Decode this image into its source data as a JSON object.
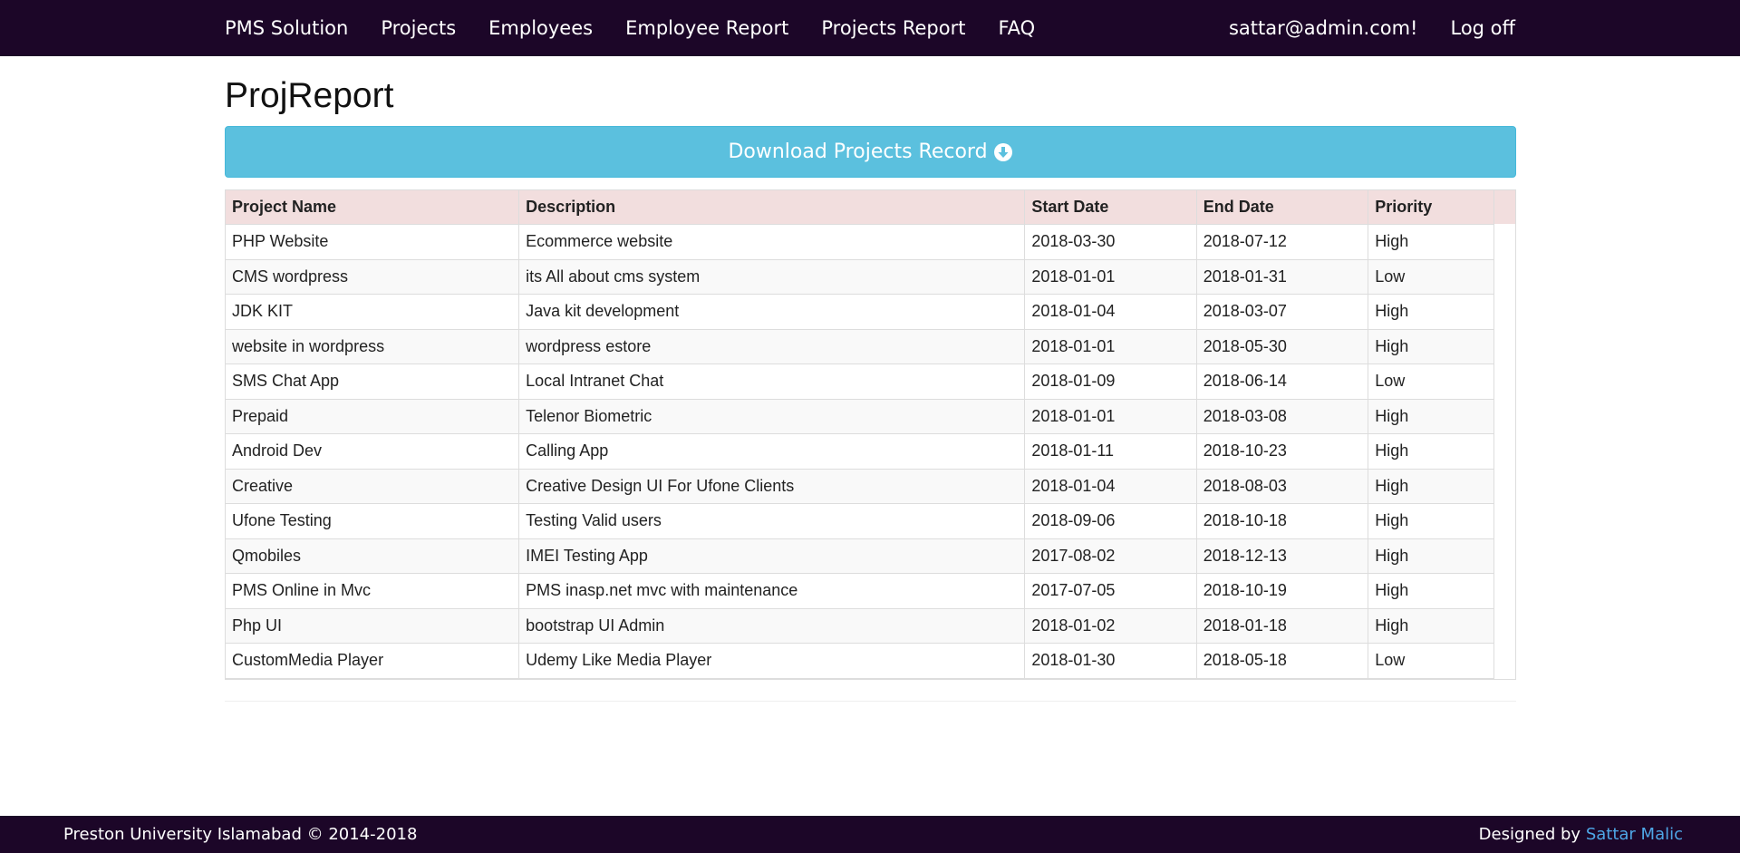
{
  "navbar": {
    "brand": "PMS Solution",
    "links": [
      "Projects",
      "Employees",
      "Employee Report",
      "Projects Report",
      "FAQ"
    ],
    "user": "sattar@admin.com!",
    "logoff": "Log off"
  },
  "page": {
    "title": "ProjReport",
    "download_label": "Download Projects Record",
    "download_icon": "download-circle-icon"
  },
  "table": {
    "headers": [
      "Project Name",
      "Description",
      "Start Date",
      "End Date",
      "Priority"
    ],
    "rows": [
      [
        "PHP Website",
        "Ecommerce website",
        "2018-03-30",
        "2018-07-12",
        "High"
      ],
      [
        "CMS wordpress",
        "its All about cms system",
        "2018-01-01",
        "2018-01-31",
        "Low"
      ],
      [
        "JDK KIT",
        "Java kit development",
        "2018-01-04",
        "2018-03-07",
        "High"
      ],
      [
        "website in wordpress",
        "wordpress estore",
        "2018-01-01",
        "2018-05-30",
        "High"
      ],
      [
        "SMS Chat App",
        "Local Intranet Chat",
        "2018-01-09",
        "2018-06-14",
        "Low"
      ],
      [
        "Prepaid",
        "Telenor Biometric",
        "2018-01-01",
        "2018-03-08",
        "High"
      ],
      [
        "Android Dev",
        "Calling App",
        "2018-01-11",
        "2018-10-23",
        "High"
      ],
      [
        "Creative",
        "Creative Design UI For Ufone Clients",
        "2018-01-04",
        "2018-08-03",
        "High"
      ],
      [
        "Ufone Testing",
        "Testing Valid users",
        "2018-09-06",
        "2018-10-18",
        "High"
      ],
      [
        "Qmobiles",
        "IMEI Testing App",
        "2017-08-02",
        "2018-12-13",
        "High"
      ],
      [
        "PMS Online in Mvc",
        "PMS inasp.net mvc with maintenance",
        "2017-07-05",
        "2018-10-19",
        "High"
      ],
      [
        "Php UI",
        "bootstrap UI Admin",
        "2018-01-02",
        "2018-01-18",
        "High"
      ],
      [
        "CustomMedia Player",
        "Udemy Like Media Player",
        "2018-01-30",
        "2018-05-18",
        "Low"
      ]
    ]
  },
  "footer": {
    "left": "Preston University Islamabad © 2014-2018",
    "designed_by": "Designed by ",
    "designer": "Sattar Malic"
  },
  "colors": {
    "navbar_bg": "#1c0628",
    "button_bg": "#5bc0de",
    "table_header_bg": "#f2dede",
    "link": "#4ea6e6"
  }
}
